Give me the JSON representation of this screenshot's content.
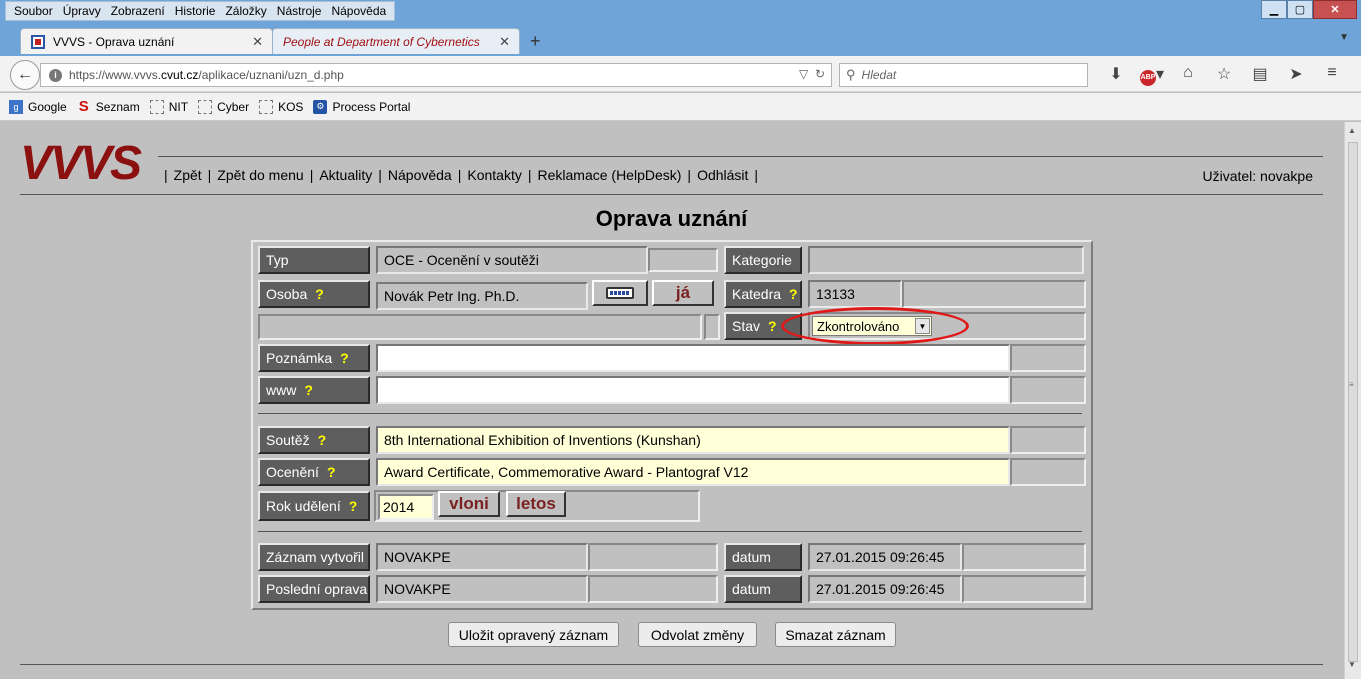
{
  "browser": {
    "menu": [
      "Soubor",
      "Úpravy",
      "Zobrazení",
      "Historie",
      "Záložky",
      "Nástroje",
      "Nápověda"
    ],
    "tabs": [
      {
        "label": "VVVS - Oprava uznání",
        "active": true
      },
      {
        "label": "People at Department of Cybernetics",
        "active": false
      }
    ],
    "new_tab": "+",
    "url_prefix": "https://www.vvvs.",
    "url_domain": "cvut.cz",
    "url_path": "/aplikace/uznani/uzn_d.php",
    "search_placeholder": "Hledat",
    "bookmarks": [
      "Google",
      "Seznam",
      "NIT",
      "Cyber",
      "KOS",
      "Process Portal"
    ],
    "abp_label": "ABP"
  },
  "header": {
    "logo": "VVVS",
    "nav": [
      "Zpět",
      "Zpět do menu",
      "Aktuality",
      "Nápověda",
      "Kontakty",
      "Reklamace (HelpDesk)",
      "Odhlásit"
    ],
    "user": "Uživatel: novakpe"
  },
  "page_title": "Oprava uznání",
  "form": {
    "typ_label": "Typ",
    "typ_value": "OCE - Ocenění v soutěži",
    "kategorie_label": "Kategorie",
    "kategorie_value": "",
    "osoba_label": "Osoba",
    "osoba_value": "Novák Petr Ing. Ph.D.",
    "ja_button": "já",
    "katedra_label": "Katedra",
    "katedra_value": "13133",
    "stav_label": "Stav",
    "stav_value": "Zkontrolováno",
    "poznamka_label": "Poznámka",
    "poznamka_value": "",
    "www_label": "www",
    "www_value": "",
    "soutez_label": "Soutěž",
    "soutez_value": "8th International Exhibition of Inventions (Kunshan)",
    "oceneni_label": "Ocenění",
    "oceneni_value": "Award Certificate, Commemorative Award - Plantograf V12",
    "rok_label": "Rok udělení",
    "rok_value": "2014",
    "vloni_button": "vloni",
    "letos_button": "letos",
    "vytvoril_label": "Záznam vytvořil",
    "vytvoril_value": "NOVAKPE",
    "datum_label": "datum",
    "datum1_value": "27.01.2015 09:26:45",
    "oprava_label": "Poslední oprava",
    "oprava_value": "NOVAKPE",
    "datum2_value": "27.01.2015 09:26:45",
    "help_mark": "?"
  },
  "buttons": {
    "save": "Uložit opravený záznam",
    "revert": "Odvolat změny",
    "delete": "Smazat záznam"
  },
  "colors": {
    "logo": "#8b1010",
    "label_bg": "#5e5e5e",
    "help_mark": "#ffff00",
    "highlight_oval": "#e01818"
  }
}
